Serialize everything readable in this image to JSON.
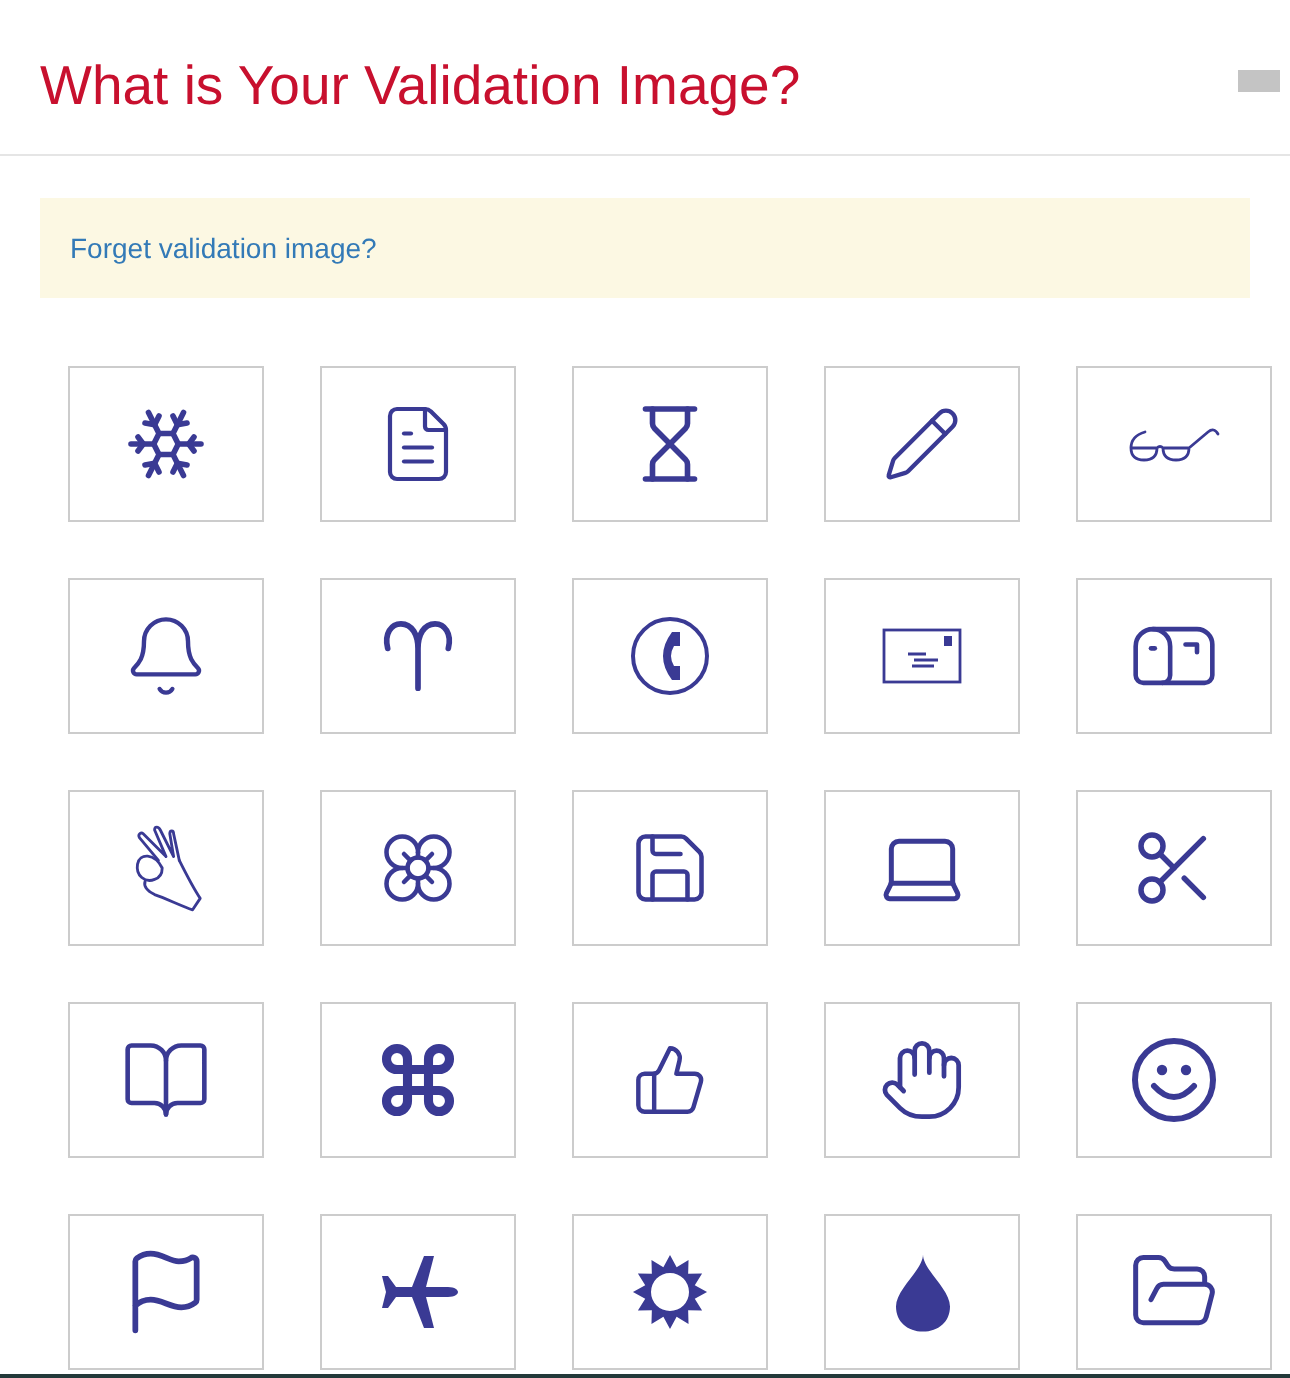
{
  "dialog": {
    "title": "What is Your Validation Image?"
  },
  "notice": {
    "link": "Forget validation image?"
  },
  "images": [
    {
      "kind": "snowflake"
    },
    {
      "kind": "document"
    },
    {
      "kind": "hourglass"
    },
    {
      "kind": "pencil"
    },
    {
      "kind": "glasses"
    },
    {
      "kind": "bell"
    },
    {
      "kind": "aries"
    },
    {
      "kind": "phone"
    },
    {
      "kind": "envelope"
    },
    {
      "kind": "mailbox"
    },
    {
      "kind": "okhand"
    },
    {
      "kind": "flower"
    },
    {
      "kind": "floppy"
    },
    {
      "kind": "laptop"
    },
    {
      "kind": "scissors"
    },
    {
      "kind": "book"
    },
    {
      "kind": "command"
    },
    {
      "kind": "thumbsup"
    },
    {
      "kind": "hand"
    },
    {
      "kind": "smiley"
    },
    {
      "kind": "flag"
    },
    {
      "kind": "airplane"
    },
    {
      "kind": "sun"
    },
    {
      "kind": "droplet"
    },
    {
      "kind": "folder"
    }
  ]
}
